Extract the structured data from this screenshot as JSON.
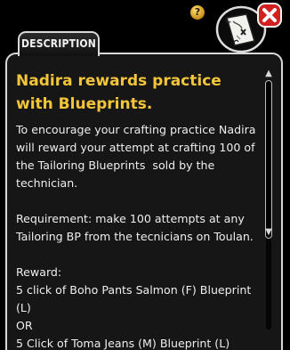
{
  "tab": {
    "label": "DESCRIPTION"
  },
  "mission": {
    "title": "Nadira rewards practice with Blueprints.",
    "description": "To encourage your crafting practice Nadira will reward your attempt at crafting 100 of the Tailoring Blueprints  sold by the technician.",
    "requirement": "Requirement: make 100 attempts at any Tailoring BP from the tecnicians on Toulan.",
    "reward_heading": "Reward:",
    "reward_option_1": "5 click of Boho Pants Salmon (F) Blueprint (L)",
    "reward_or": "OR",
    "reward_option_2": "5 Click of Toma Jeans (M) Blueprint (L)"
  },
  "icons": {
    "help": "question-mark-icon",
    "map": "map-scroll-icon",
    "close": "close-x-icon",
    "scroll_up": "triangle-up-icon",
    "scroll_down": "triangle-down-icon"
  },
  "help_glyph": "?",
  "scroll_glyphs": {
    "up": "▲",
    "down": "▼"
  },
  "colors": {
    "title": "#f3c53a",
    "text": "#eeeeee",
    "panel_bg": "#161616",
    "border": "#d9d9d9",
    "close_red": "#d21f1f"
  }
}
